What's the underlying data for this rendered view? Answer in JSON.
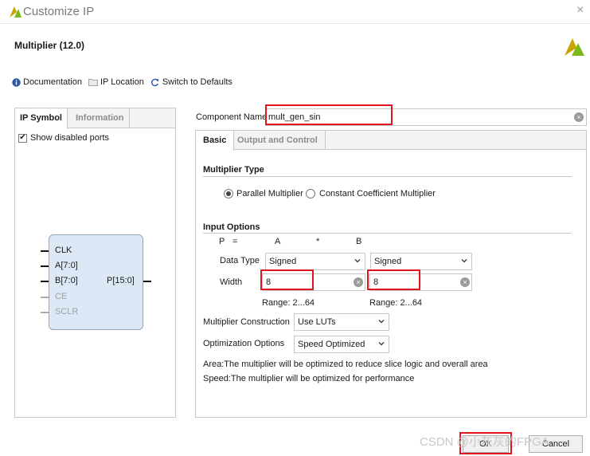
{
  "window": {
    "title": "Customize IP",
    "close_symbol": "×"
  },
  "header": {
    "title": "Multiplier (12.0)"
  },
  "toolbar": {
    "documentation": "Documentation",
    "ip_location": "IP Location",
    "switch_defaults": "Switch to Defaults"
  },
  "left_panel": {
    "tabs": [
      {
        "label": "IP Symbol"
      },
      {
        "label": "Information"
      }
    ],
    "show_disabled_ports": "Show disabled ports",
    "check_mark": "✔",
    "ports_in": [
      {
        "label": "CLK",
        "enabled": true
      },
      {
        "label": "A[7:0]",
        "enabled": true
      },
      {
        "label": "B[7:0]",
        "enabled": true
      },
      {
        "label": "CE",
        "enabled": false
      },
      {
        "label": "SCLR",
        "enabled": false
      }
    ],
    "ports_out": [
      {
        "label": "P[15:0]",
        "enabled": true
      }
    ]
  },
  "component": {
    "label": "Component Name",
    "value": "mult_gen_sin"
  },
  "right_panel": {
    "tabs": [
      {
        "label": "Basic"
      },
      {
        "label": "Output and Control"
      }
    ],
    "multiplier_type": {
      "title": "Multiplier Type",
      "options": [
        {
          "label": "Parallel Multiplier",
          "selected": true
        },
        {
          "label": "Constant Coefficient Multiplier",
          "selected": false
        }
      ]
    },
    "input_options": {
      "title": "Input Options",
      "equation": {
        "p": "P",
        "eq": "=",
        "a": "A",
        "times": "*",
        "b": "B"
      },
      "data_type_label": "Data Type",
      "data_type_a": "Signed",
      "data_type_b": "Signed",
      "width_label": "Width",
      "width_a": "8",
      "width_b": "8",
      "range_a": "Range: 2...64",
      "range_b": "Range: 2...64"
    },
    "construction": {
      "label": "Multiplier Construction",
      "value": "Use LUTs"
    },
    "optimization": {
      "label": "Optimization Options",
      "value": "Speed Optimized"
    },
    "notes": [
      "Area:The multiplier will be optimized to reduce slice logic and overall area",
      "Speed:The multiplier will be optimized for performance"
    ]
  },
  "footer": {
    "ok": "OK",
    "cancel": "Cancel",
    "watermark": "CSDN @小灰灰的FPGA"
  },
  "colors": {
    "highlight": "#e2141f",
    "symbol_fill": "#dde8f6"
  },
  "icons": {
    "app_logo": "xilinx-logo-icon",
    "brand_logo": "xilinx-brand-icon",
    "doc": "info-icon",
    "folder": "folder-icon",
    "refresh": "refresh-icon"
  }
}
